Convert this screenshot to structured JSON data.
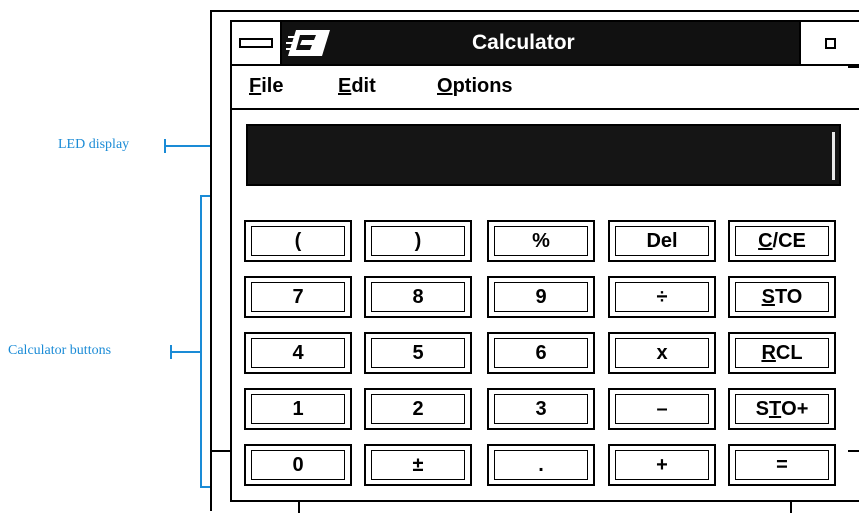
{
  "callouts": {
    "led_display": "LED display",
    "calculator_buttons": "Calculator buttons"
  },
  "window": {
    "title": "Calculator",
    "menu": [
      {
        "accel": "F",
        "rest": "ile"
      },
      {
        "accel": "E",
        "rest": "dit"
      },
      {
        "accel": "O",
        "rest": "ptions"
      }
    ]
  },
  "display": {
    "value": ""
  },
  "buttons": [
    {
      "label": "("
    },
    {
      "label": ")"
    },
    {
      "label": "%"
    },
    {
      "label": "Del"
    },
    {
      "pre": "",
      "accel": "C",
      "post": "/CE"
    },
    {
      "label": "7"
    },
    {
      "label": "8"
    },
    {
      "label": "9"
    },
    {
      "label": "÷"
    },
    {
      "pre": "",
      "accel": "S",
      "post": "TO"
    },
    {
      "label": "4"
    },
    {
      "label": "5"
    },
    {
      "label": "6"
    },
    {
      "label": "x"
    },
    {
      "pre": "",
      "accel": "R",
      "post": "CL"
    },
    {
      "label": "1"
    },
    {
      "label": "2"
    },
    {
      "label": "3"
    },
    {
      "label": "–"
    },
    {
      "pre": "S",
      "accel": "T",
      "post": "O+"
    },
    {
      "label": "0"
    },
    {
      "label": "±"
    },
    {
      "label": "."
    },
    {
      "label": "+"
    },
    {
      "label": "="
    }
  ]
}
